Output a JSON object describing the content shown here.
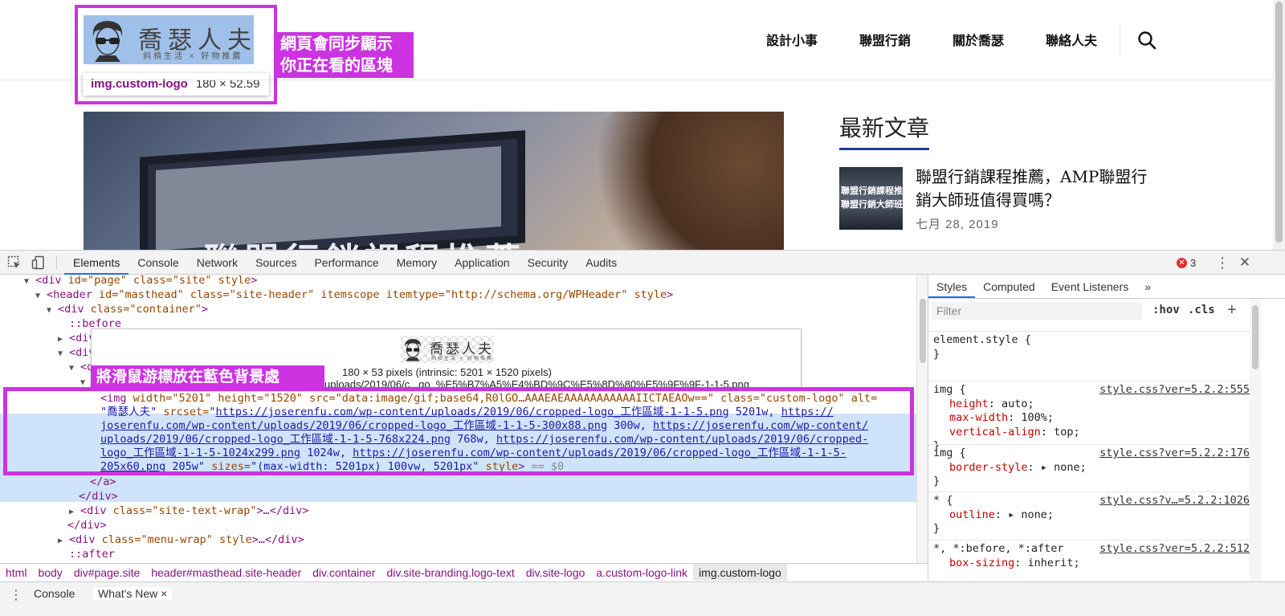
{
  "site": {
    "logo": {
      "title": "喬瑟人夫",
      "subtitle": "斜槓生活 × 好物推薦"
    },
    "tooltip": {
      "selector": "img.custom-logo",
      "size": "180 × 52.59"
    },
    "note_top": [
      "網頁會同步顯示",
      "你正在看的區塊"
    ],
    "nav": [
      "設計小事",
      "聯盟行銷",
      "關於喬瑟",
      "聯絡人夫"
    ],
    "hero_caption": "聯盟行銷課程推薦",
    "sidebar_title": "最新文章",
    "thumb_text": [
      "聯盟行銷課程推薦",
      "聯盟行銷大師班"
    ],
    "post_title": "聯盟行銷課程推薦，AMP聯盟行銷大師班值得買嗎？",
    "post_date": "七月 28, 2019"
  },
  "devtools": {
    "tabs": [
      "Elements",
      "Console",
      "Network",
      "Sources",
      "Performance",
      "Memory",
      "Application",
      "Security",
      "Audits"
    ],
    "active_tab": "Elements",
    "error_count": "3",
    "styles_tabs": [
      "Styles",
      "Computed",
      "Event Listeners",
      "»"
    ],
    "filter_placeholder": "Filter",
    "hov": ":hov",
    "cls": ".cls",
    "note_mid": "將滑鼠游標放在藍色背景處",
    "preview": {
      "logo_title": "喬瑟人夫",
      "logo_subtitle": "斜槓生活 × 好物推薦",
      "dims": "180 × 53 pixels (intrinsic: 5201 × 1520 pixels)",
      "url": "uploads/2019/06/c...go_%E5%B7%A5%E4%BD%9C%E5%8D%80%E5%9F%9F-1-1-5.png"
    },
    "tree": {
      "l1_tag": "div",
      "l1_attrs": "id=\"page\" class=\"site\" style",
      "l2_attrs": "id=\"masthead\" class=\"site-header\" itemscope itemtype=\"http://schema.org/WPHeader\" style",
      "l3": "class=\"container\"",
      "before": "::before",
      "after": "::after",
      "img_attrs": "width=\"5201\" height=\"1520\" src=\"data:image/gif;base64,R0lGO…AAAEAEAAAAAAAAAAAIICTAEAOw==\" class=\"custom-logo\" alt=",
      "alt_val": "\"喬瑟人夫\"",
      "srcset_a": "https://joserenfu.com/wp-content/uploads/2019/06/cropped-logo_工作區域-1-1-5.png",
      "srcset_a_w": " 5201w, ",
      "srcset_b": "https://",
      "srcset_c": "joserenfu.com/wp-content/uploads/2019/06/cropped-logo_工作區域-1-1-5-300x88.png",
      "srcset_c_w": " 300w, ",
      "srcset_d": "https://joserenfu.com/wp-content/",
      "srcset_e": "uploads/2019/06/cropped-logo_工作區域-1-1-5-768x224.png",
      "srcset_e_w": " 768w, ",
      "srcset_f": "https://joserenfu.com/wp-content/uploads/2019/06/cropped-",
      "srcset_g": "logo_工作區域-1-1-5-1024x299.png",
      "srcset_g_w": " 1024w, ",
      "srcset_h": "https://joserenfu.com/wp-content/uploads/2019/06/cropped-logo_工作區域-1-1-5-",
      "srcset_i": "205x60.png",
      "sizes": "(max-width: 5201px) 100vw, 5201px",
      "eq": "== $0",
      "site_text_wrap": "class=\"site-text-wrap\"",
      "menu_wrap": "class=\"menu-wrap\" style"
    },
    "styles": [
      {
        "selector": "element.style {",
        "src": "",
        "props": []
      },
      {
        "selector": "img {",
        "src": "style.css?ver=5.2.2:555",
        "props": [
          [
            "height",
            "auto;"
          ],
          [
            "max-width",
            "100%;"
          ],
          [
            "vertical-align",
            "top;"
          ]
        ]
      },
      {
        "selector": "img {",
        "src": "style.css?ver=5.2.2:176",
        "props": [
          [
            "border-style",
            "▸ none;"
          ]
        ]
      },
      {
        "selector": "* {",
        "src": "style.css?v…=5.2.2:1026",
        "props": [
          [
            "outline",
            "▸ none;"
          ]
        ]
      },
      {
        "selector": "*, *:before, *:after",
        "src": "style.css?ver=5.2.2:512",
        "props": [
          [
            "box-sizing",
            "inherit;"
          ]
        ]
      }
    ],
    "breadcrumbs": [
      {
        "t": "html",
        "c": ""
      },
      {
        "t": "body",
        "c": ""
      },
      {
        "t": "div",
        "c": "#page.site"
      },
      {
        "t": "header",
        "c": "#masthead.site-header"
      },
      {
        "t": "div",
        "c": ".container"
      },
      {
        "t": "div",
        "c": ".site-branding.logo-text"
      },
      {
        "t": "div",
        "c": ".site-logo"
      },
      {
        "t": "a",
        "c": ".custom-logo-link"
      },
      {
        "t": "img",
        "c": ".custom-logo"
      }
    ],
    "drawer": {
      "console": "Console",
      "whats_new": "What's New ×"
    }
  },
  "colors": {
    "highlight": "#cc33e0",
    "selection": "#cfe3fa",
    "tag": "#881280",
    "attr": "#994500",
    "value": "#1a1aa6"
  }
}
